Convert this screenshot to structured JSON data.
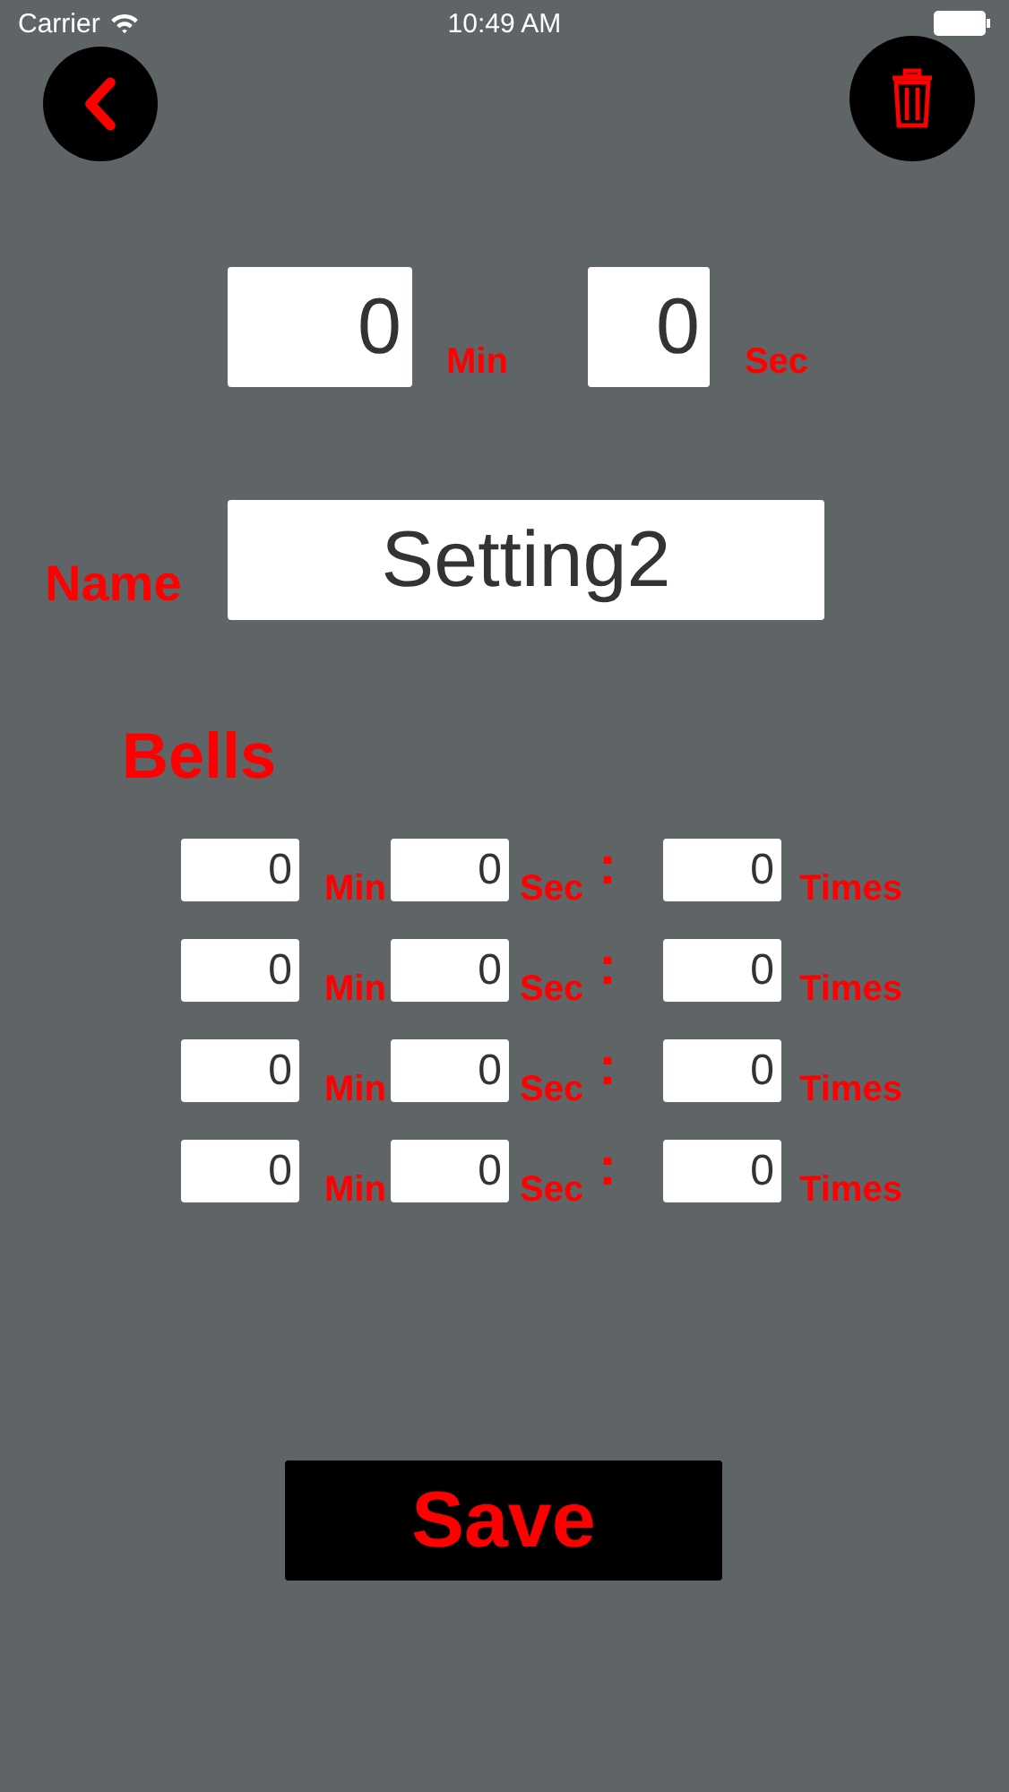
{
  "status_bar": {
    "carrier": "Carrier",
    "time": "10:49 AM"
  },
  "timer": {
    "minutes": "0",
    "minutes_label": "Min",
    "seconds": "0",
    "seconds_label": "Sec"
  },
  "name": {
    "label": "Name",
    "value": "Setting2"
  },
  "bells": {
    "title": "Bells",
    "rows": [
      {
        "minutes": "0",
        "minutes_label": "Min",
        "seconds": "0",
        "seconds_label": "Sec",
        "separator": ":",
        "times": "0",
        "times_label": "Times"
      },
      {
        "minutes": "0",
        "minutes_label": "Min",
        "seconds": "0",
        "seconds_label": "Sec",
        "separator": ":",
        "times": "0",
        "times_label": "Times"
      },
      {
        "minutes": "0",
        "minutes_label": "Min",
        "seconds": "0",
        "seconds_label": "Sec",
        "separator": ":",
        "times": "0",
        "times_label": "Times"
      },
      {
        "minutes": "0",
        "minutes_label": "Min",
        "seconds": "0",
        "seconds_label": "Sec",
        "separator": ":",
        "times": "0",
        "times_label": "Times"
      }
    ]
  },
  "save_button": "Save"
}
